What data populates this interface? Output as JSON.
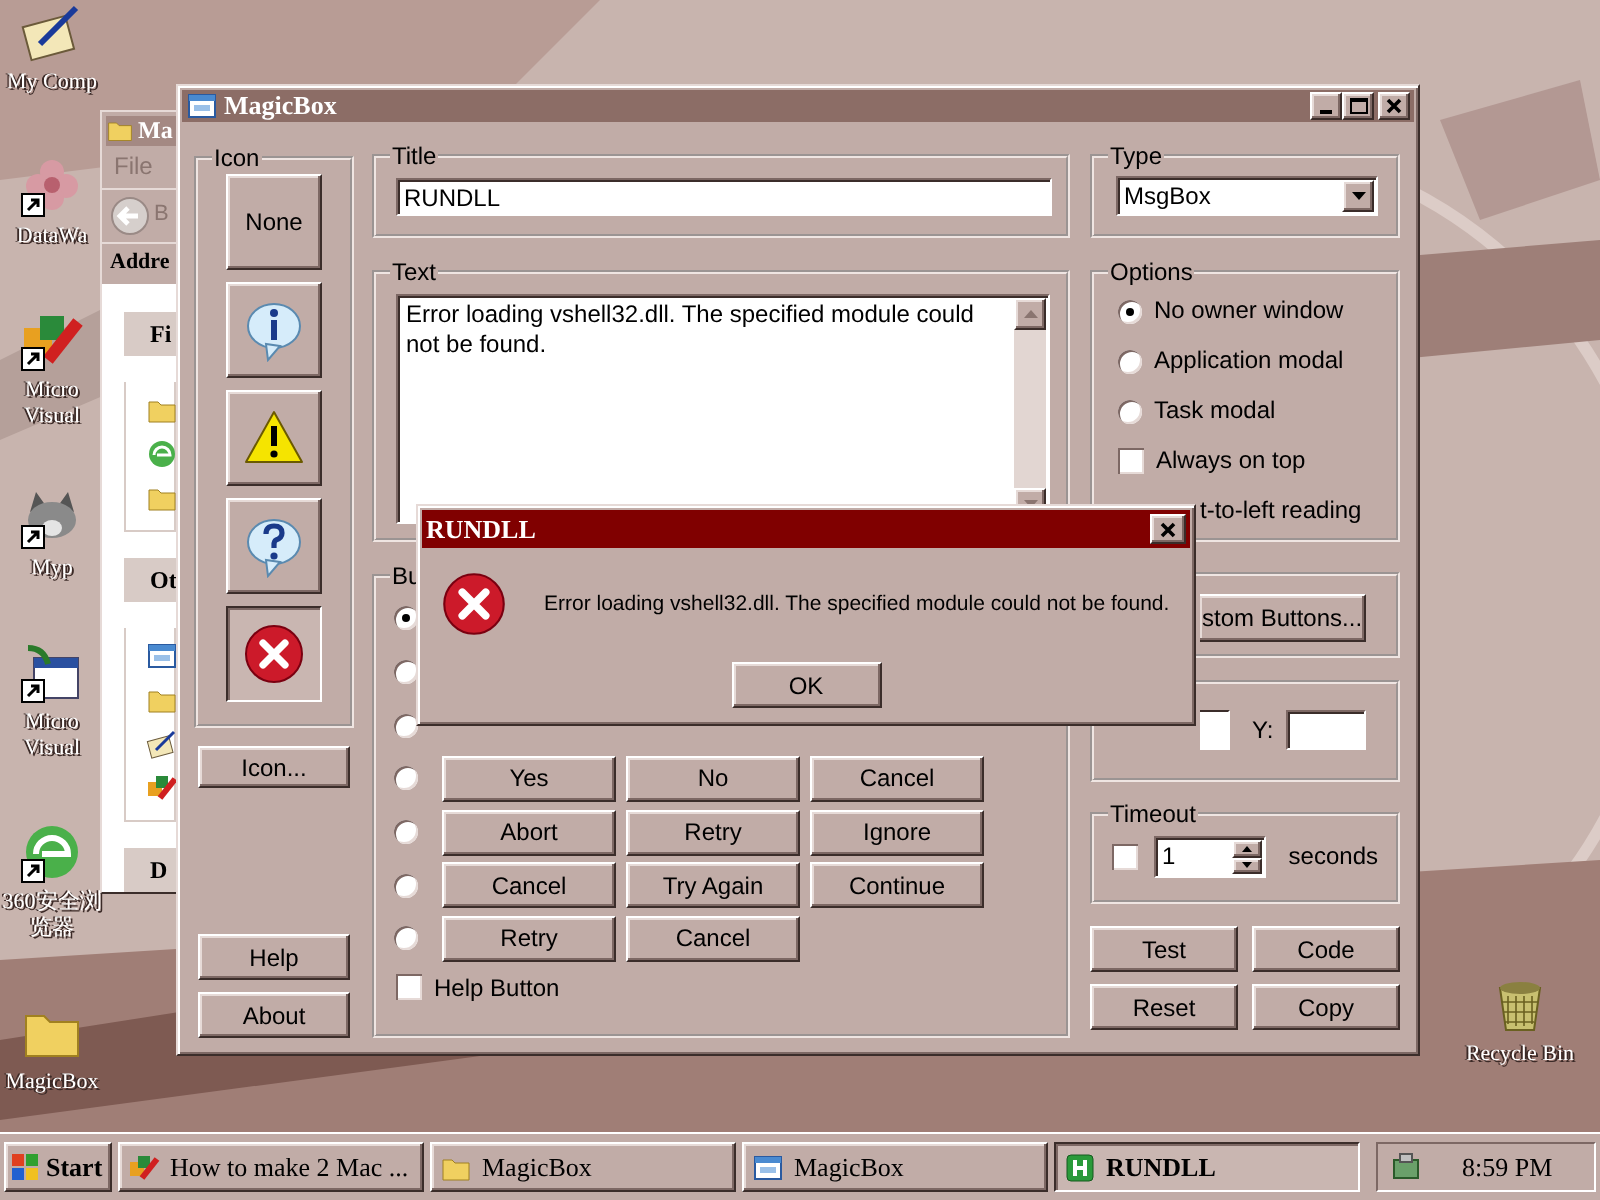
{
  "desktop": {
    "left_icons": [
      {
        "label": "My Comp",
        "kind": "notebook",
        "shortcut": false
      },
      {
        "label": "DataWa",
        "kind": "flower",
        "shortcut": true
      },
      {
        "label": "Micro Visual",
        "kind": "tools",
        "shortcut": true
      },
      {
        "label": "Myp",
        "kind": "animal",
        "shortcut": true
      },
      {
        "label": "Micro Visual",
        "kind": "calendar",
        "shortcut": true
      },
      {
        "label": "360安全浏览器",
        "kind": "globe",
        "shortcut": true
      },
      {
        "label": "MagicBox",
        "kind": "folder",
        "shortcut": false
      }
    ],
    "right_icons": [
      {
        "label": "Recycle Bin",
        "kind": "bin",
        "shortcut": false
      }
    ]
  },
  "explorer": {
    "title": "Ma",
    "menu": [
      "File"
    ],
    "back_label": "B",
    "address_label": "Addre",
    "panels": [
      {
        "title": "Fi",
        "items": [
          {
            "kind": "folder"
          },
          {
            "kind": "globe"
          },
          {
            "kind": "folder"
          }
        ]
      },
      {
        "title": "Ot",
        "items": [
          {
            "kind": "window"
          },
          {
            "kind": "folder"
          },
          {
            "kind": "notebook"
          },
          {
            "kind": "tools"
          }
        ]
      },
      {
        "title": "D"
      }
    ]
  },
  "magicbox": {
    "title": "MagicBox",
    "icon_group": {
      "label": "Icon",
      "choices": [
        {
          "kind": "text",
          "label": "None",
          "selected": false
        },
        {
          "kind": "info",
          "selected": false
        },
        {
          "kind": "warning",
          "selected": false
        },
        {
          "kind": "question",
          "selected": false
        },
        {
          "kind": "error",
          "selected": true
        }
      ],
      "icon_button": "Icon..."
    },
    "left_buttons": [
      "Help",
      "About"
    ],
    "title_group": {
      "label": "Title",
      "value": "RUNDLL"
    },
    "text_group": {
      "label": "Text",
      "value": "Error loading vshell32.dll. The specified module could not be found."
    },
    "buttons_group": {
      "label": "Bu",
      "rows": [
        {
          "selected": true
        },
        {
          "selected": false
        },
        {
          "selected": false
        },
        {
          "selected": false,
          "buttons": [
            "Yes",
            "No",
            "Cancel"
          ]
        },
        {
          "selected": false,
          "buttons": [
            "Abort",
            "Retry",
            "Ignore"
          ]
        },
        {
          "selected": false,
          "buttons": [
            "Cancel",
            "Try Again",
            "Continue"
          ]
        },
        {
          "selected": false,
          "buttons": [
            "Retry",
            "Cancel"
          ]
        }
      ],
      "help_checkbox": {
        "label": "Help Button",
        "checked": false
      }
    },
    "type_group": {
      "label": "Type",
      "value": "MsgBox"
    },
    "options_group": {
      "label": "Options",
      "items": [
        {
          "kind": "radio",
          "label": "No owner window",
          "selected": true
        },
        {
          "kind": "radio",
          "label": "Application modal",
          "selected": false
        },
        {
          "kind": "radio",
          "label": "Task modal",
          "selected": false
        },
        {
          "kind": "checkbox",
          "label": "Always on top",
          "checked": false
        },
        {
          "kind": "partial",
          "label": "t-to-left reading"
        }
      ]
    },
    "custom_button": "stom Buttons...",
    "position_group": {
      "y_label": "Y:"
    },
    "timeout_group": {
      "label": "Timeout",
      "checked": false,
      "value": "1",
      "unit": "seconds"
    },
    "action_buttons": [
      "Test",
      "Code",
      "Reset",
      "Copy"
    ]
  },
  "dialog": {
    "title": "RUNDLL",
    "message": "Error loading vshell32.dll. The specified module could not be found.",
    "button": "OK"
  },
  "taskbar": {
    "start": "Start",
    "tasks": [
      {
        "label": "How to make 2 Mac ...",
        "kind": "tools",
        "selected": false
      },
      {
        "label": "MagicBox",
        "kind": "folder",
        "selected": false
      },
      {
        "label": "MagicBox",
        "kind": "window",
        "selected": false
      },
      {
        "label": "RUNDLL",
        "kind": "app",
        "selected": true
      }
    ],
    "clock": "8:59 PM"
  }
}
